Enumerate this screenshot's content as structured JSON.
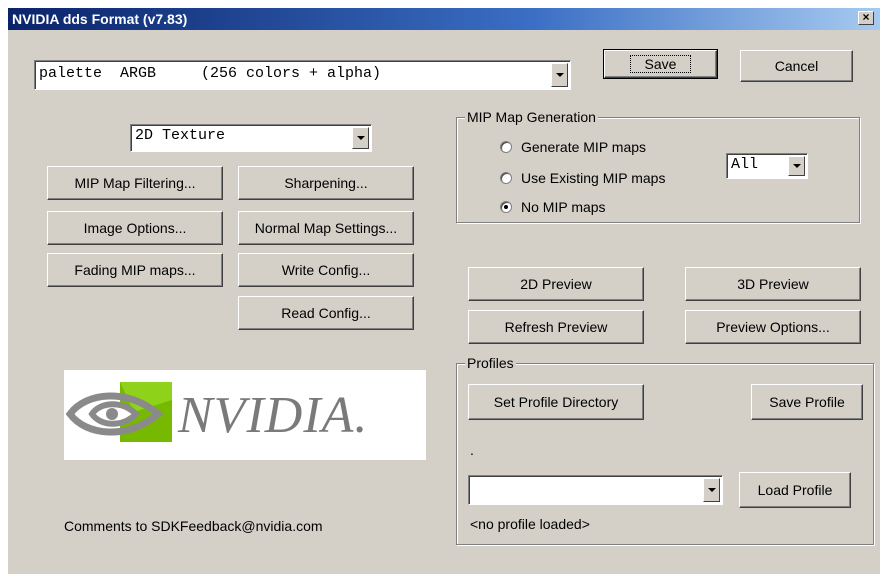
{
  "window": {
    "title": "NVIDIA dds Format (v7.83)",
    "close_symbol": "×"
  },
  "format_combo": {
    "value": "palette  ARGB     (256 colors + alpha)"
  },
  "buttons": {
    "save": "Save",
    "cancel": "Cancel",
    "mip_map_filtering": "MIP Map Filtering...",
    "sharpening": "Sharpening...",
    "image_options": "Image Options...",
    "normal_map_settings": "Normal Map Settings...",
    "fading_mip_maps": "Fading MIP maps...",
    "write_config": "Write Config...",
    "read_config": "Read Config...",
    "preview_2d": "2D Preview",
    "preview_3d": "3D Preview",
    "refresh_preview": "Refresh Preview",
    "preview_options": "Preview Options...",
    "set_profile_directory": "Set Profile Directory",
    "save_profile": "Save Profile",
    "load_profile": "Load Profile"
  },
  "texture_combo": {
    "value": "2D Texture"
  },
  "mip_group": {
    "legend": "MIP Map Generation",
    "options": [
      {
        "label": "Generate MIP maps",
        "selected": false
      },
      {
        "label": "Use Existing MIP maps",
        "selected": false
      },
      {
        "label": "No MIP maps",
        "selected": true
      }
    ],
    "levels_combo": "All"
  },
  "profiles": {
    "legend": "Profiles",
    "directory_text": ".",
    "profile_combo": "",
    "status": "<no profile loaded>"
  },
  "logo": {
    "wordmark": "NVIDIA."
  },
  "comments": "Comments to SDKFeedback@nvidia.com",
  "colors": {
    "face": "#d4d0c8",
    "title_start": "#0a246a",
    "title_end": "#a6caf0",
    "logo_green": "#76b900"
  }
}
